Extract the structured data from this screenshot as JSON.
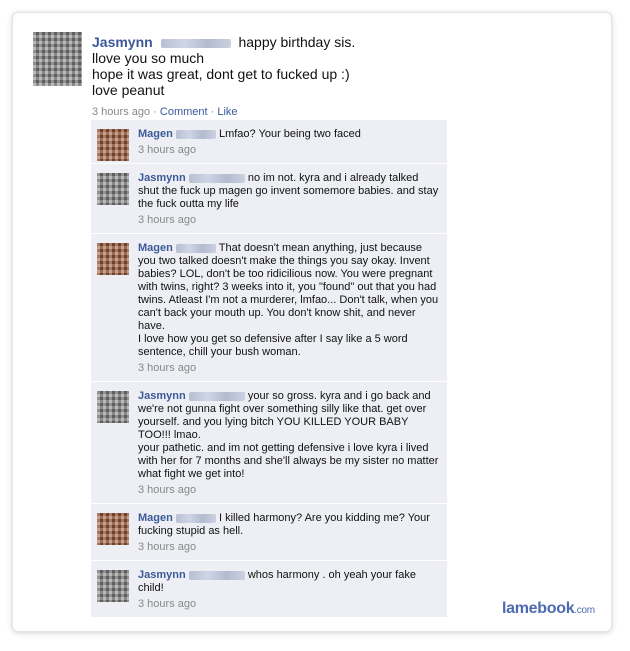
{
  "post": {
    "author": "Jasmynn",
    "lines": [
      "happy birthday sis.",
      "llove you so much",
      "hope it was great, dont get to fucked up :)",
      "love peanut"
    ],
    "time": "3 hours ago",
    "sep": " · ",
    "comment_link": "Comment",
    "like_link": "Like"
  },
  "comments": [
    {
      "author": "Magen",
      "text": "Lmfao? Your being two faced",
      "time": "3 hours ago"
    },
    {
      "author": "Jasmynn",
      "text": "no im not. kyra and i already talked shut the fuck up magen go invent somemore babies. and stay the fuck outta my life",
      "time": "3 hours ago"
    },
    {
      "author": "Magen",
      "text": "That doesn't mean anything, just because you two talked doesn't make the things you say okay. Invent babies? LOL, don't be too ridicilious now. You were pregnant with twins, right? 3 weeks into it, you \"found\" out that you had twins. Atleast I'm not a murderer, lmfao... Don't talk, when you can't back your mouth up. You don't know shit, and never have.\nI love how you get so defensive after I say like a 5 word sentence, chill your bush woman.",
      "time": "3 hours ago"
    },
    {
      "author": "Jasmynn",
      "text": "your so gross. kyra and i go back and we're not gunna fight over something silly like that. get over yourself. and you lying bitch YOU KILLED YOUR BABY TOO!!! lmao.\nyour pathetic. and im not getting defensive i love kyra i lived with her for 7 months and she'll always be my sister no matter what fight we get into!",
      "time": "3 hours ago"
    },
    {
      "author": "Magen",
      "text": "I killed harmony? Are you kidding me? Your fucking stupid as hell.",
      "time": "3 hours ago"
    },
    {
      "author": "Jasmynn",
      "text": "whos harmony . oh yeah your fake child!",
      "time": "3 hours ago"
    }
  ],
  "brand": {
    "name": "lamebook",
    "suffix": ".com"
  }
}
